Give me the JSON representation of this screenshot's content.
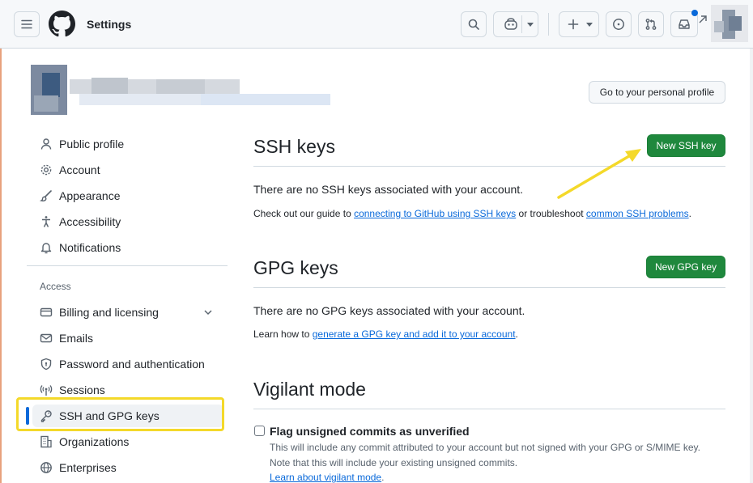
{
  "header": {
    "title": "Settings",
    "icons": [
      "menu-icon",
      "github-logo",
      "search-icon",
      "copilot-icon",
      "plus-icon",
      "issues-icon",
      "pull-requests-icon",
      "inbox-icon"
    ]
  },
  "profile": {
    "go_to_profile": "Go to your personal profile"
  },
  "sidebar": {
    "items": [
      {
        "label": "Public profile"
      },
      {
        "label": "Account"
      },
      {
        "label": "Appearance"
      },
      {
        "label": "Accessibility"
      },
      {
        "label": "Notifications"
      }
    ],
    "access_heading": "Access",
    "access_items": [
      {
        "label": "Billing and licensing"
      },
      {
        "label": "Emails"
      },
      {
        "label": "Password and authentication"
      },
      {
        "label": "Sessions"
      },
      {
        "label": "SSH and GPG keys"
      },
      {
        "label": "Organizations"
      },
      {
        "label": "Enterprises"
      }
    ]
  },
  "ssh": {
    "title": "SSH keys",
    "new_button": "New SSH key",
    "empty": "There are no SSH keys associated with your account.",
    "guide_prefix": "Check out our guide to ",
    "guide_link": "connecting to GitHub using SSH keys",
    "guide_mid": " or troubleshoot ",
    "guide_link2": "common SSH problems",
    "guide_suffix": "."
  },
  "gpg": {
    "title": "GPG keys",
    "new_button": "New GPG key",
    "empty": "There are no GPG keys associated with your account.",
    "learn_prefix": "Learn how to ",
    "learn_link": "generate a GPG key and add it to your account",
    "learn_suffix": "."
  },
  "vigilant": {
    "title": "Vigilant mode",
    "checkbox_label": "Flag unsigned commits as unverified",
    "desc1": "This will include any commit attributed to your account but not signed with your GPG or S/MIME key.",
    "desc2": "Note that this will include your existing unsigned commits.",
    "learn_link": "Learn about vigilant mode",
    "learn_suffix": "."
  },
  "colors": {
    "accent": "#0969da",
    "green": "#1f883d",
    "highlight": "#f4d92a"
  }
}
